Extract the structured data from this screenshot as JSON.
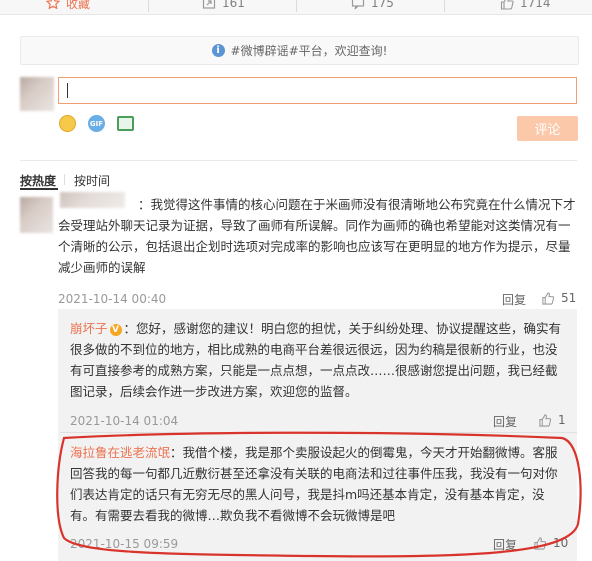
{
  "topbar": {
    "favorite": "收藏",
    "repost_count": "161",
    "comment_count": "175",
    "like_count": "1714"
  },
  "notice": {
    "text": "#微博辟谣#平台，欢迎查询!"
  },
  "composer": {
    "input_value": "",
    "submit_label": "评论"
  },
  "sort": {
    "by_heat": "按热度",
    "by_time": "按时间"
  },
  "comments": [
    {
      "name": "",
      "text": "：我觉得这件事情的核心问题在于米画师没有很清晰地公布究竟在什么情况下才会受理站外聊天记录为证据，导致了画师有所误解。同作为画师的确也希望能对这类情况有一个清晰的公示，包括退出企划时选项对完成率的影响也应该写在更明显的地方作为提示，尽量减少画师的误解",
      "time": "2021-10-14 00:40",
      "reply_label": "回复",
      "likes": "51"
    }
  ],
  "replies": [
    {
      "name": "崩坏子",
      "badge": "V",
      "text": "：您好，感谢您的建议！明白您的担忧，关于纠纷处理、协议提醒这些，确实有很多做的不到位的地方，相比成熟的电商平台差很远很远，因为约稿是很新的行业，也没有可直接参考的成熟方案，只能是一点点想，一点点改……很感谢您提出问题，我已经截图记录，后续会作进一步改进方案，欢迎您的监督。",
      "time": "2021-10-14 01:04",
      "reply_label": "回复",
      "likes": "1"
    },
    {
      "name": "海拉鲁在逃老流氓",
      "text": "：我借个楼，我是那个卖服设起火的倒霉鬼，今天才开始翻微博。客服回答我的每一句都几近敷衍甚至还拿没有关联的电商法和过往事件压我，我没有一句对你们表达肯定的话只有无穷无尽的黑人问号，我是抖m吗还基本肯定，没有基本肯定，没有。有需要去看我的微博…欺负我不看微博不会玩微博是吧",
      "time": "2021-10-15 09:59",
      "reply_label": "回复",
      "likes": "10"
    }
  ],
  "colors": {
    "accent": "#eb7350",
    "annotation_red": "#d9342b"
  }
}
